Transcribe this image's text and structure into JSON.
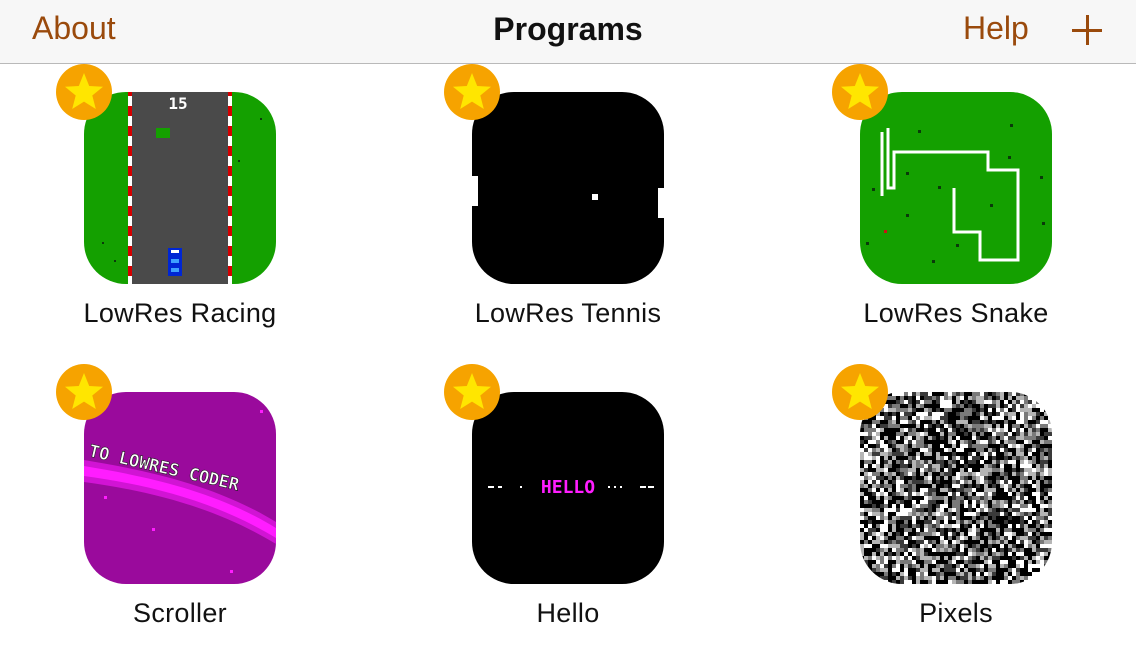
{
  "navbar": {
    "about_label": "About",
    "title": "Programs",
    "help_label": "Help",
    "add_icon": "plus-icon",
    "tint_color": "#9a4a0c"
  },
  "programs": [
    {
      "label": "LowRes Racing",
      "favorite": true,
      "icon": "racing-icon",
      "score": "15"
    },
    {
      "label": "LowRes Tennis",
      "favorite": true,
      "icon": "tennis-icon"
    },
    {
      "label": "LowRes Snake",
      "favorite": true,
      "icon": "snake-icon"
    },
    {
      "label": "Scroller",
      "favorite": true,
      "icon": "scroller-icon",
      "banner_text": "TO LOWRES CODER"
    },
    {
      "label": "Hello",
      "favorite": true,
      "icon": "hello-icon",
      "screen_text": "HELLO"
    },
    {
      "label": "Pixels",
      "favorite": true,
      "icon": "pixels-icon"
    }
  ],
  "colors": {
    "star_fill": "#ffe600",
    "star_badge": "#f6a300",
    "grass": "#14a000",
    "road": "#4a4a4a",
    "magenta": "#ff1dff",
    "purple": "#9a0a9c"
  }
}
